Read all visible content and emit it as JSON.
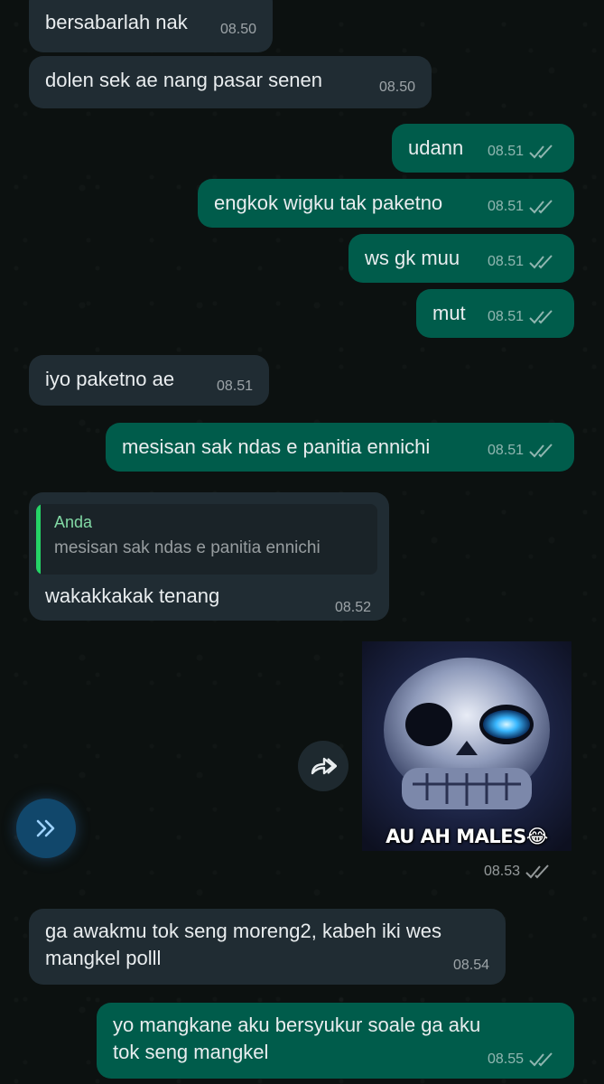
{
  "messages": [
    {
      "text": "bersabarlah nak",
      "time": "08.50",
      "dir": "in"
    },
    {
      "text": "dolen sek ae nang pasar senen",
      "time": "08.50",
      "dir": "in"
    },
    {
      "text": "udann",
      "time": "08.51",
      "dir": "out"
    },
    {
      "text": "engkok wigku tak paketno",
      "time": "08.51",
      "dir": "out"
    },
    {
      "text": "ws gk muu",
      "time": "08.51",
      "dir": "out"
    },
    {
      "text": "mut",
      "time": "08.51",
      "dir": "out"
    },
    {
      "text": "iyo paketno ae",
      "time": "08.51",
      "dir": "in"
    },
    {
      "text": "mesisan sak ndas e panitia ennichi",
      "time": "08.51",
      "dir": "out"
    },
    {
      "text": "wakakkakak tenang",
      "time": "08.52",
      "dir": "in",
      "quote": {
        "author": "Anda",
        "text": "mesisan sak ndas e panitia ennichi"
      }
    },
    {
      "image_caption": "AU AH MALES😂",
      "time": "08.53",
      "dir": "out"
    },
    {
      "text": "ga awakmu tok seng moreng2, kabeh iki wes\nmangkel polll",
      "time": "08.54",
      "dir": "in"
    },
    {
      "text": "yo mangkane aku bersyukur soale ga aku\ntok seng mangkel",
      "time": "08.55",
      "dir": "out"
    }
  ],
  "icons": {
    "read_ticks": "double-check-icon",
    "forward": "forward-icon",
    "scroll": "double-chevron-right-icon"
  },
  "colors": {
    "incoming_bubble": "#202c33",
    "outgoing_bubble": "#005c4b",
    "quote_author": "#82d9a5",
    "fab": "#11476b"
  }
}
